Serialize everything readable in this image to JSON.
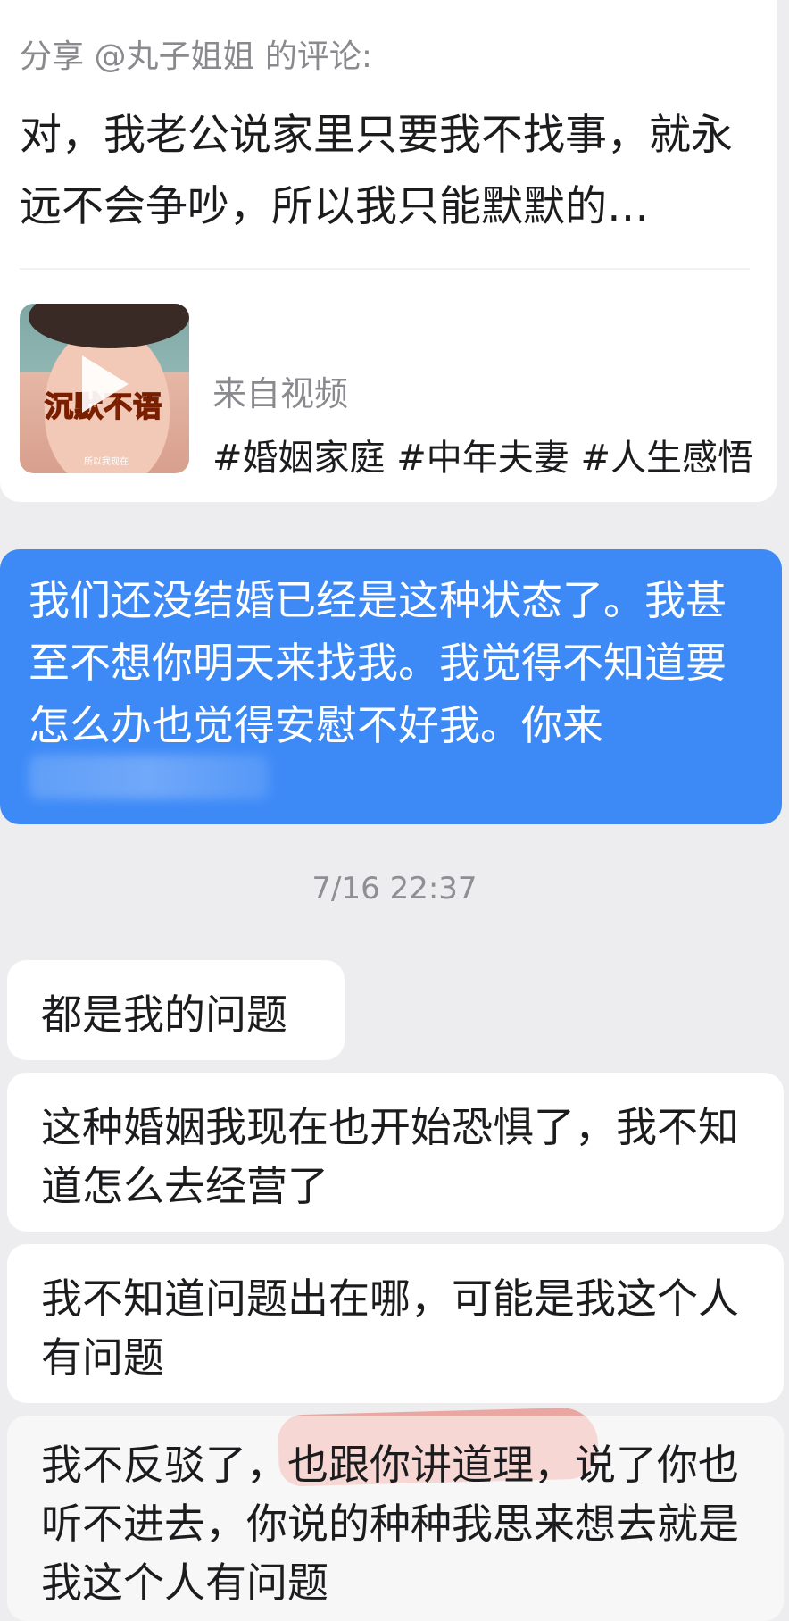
{
  "share": {
    "header": "分享 @丸子姐姐 的评论:",
    "comment": "对，我老公说家里只要我不找事，就永远不会争吵，所以我只能默默的…",
    "video": {
      "thumbnail_caption": "沉默不语",
      "thumbnail_subcaption": "所以我现在",
      "source": "来自视频",
      "tags": "#婚姻家庭 #中年夫妻 #人生感悟"
    }
  },
  "sent_message": {
    "text": "我们还没结婚已经是这种状态了。我甚至不想你明天来找我。我觉得不知道要怎么办也觉得安慰不好我。你来"
  },
  "timestamp": "7/16 22:37",
  "received_messages": [
    {
      "text": "都是我的问题"
    },
    {
      "text": "这种婚姻我现在也开始恐惧了，我不知道怎么去经营了"
    },
    {
      "text": "我不知道问题出在哪，可能是我这个人有问题"
    },
    {
      "text": "我不反驳了，也跟你讲道理，说了你也听不进去，你说的种种我思来想去就是我这个人有问题"
    }
  ],
  "colors": {
    "sent_bubble": "#3d8af7",
    "received_bubble": "#ffffff",
    "background": "#ededef",
    "highlight": "#e76e60"
  }
}
